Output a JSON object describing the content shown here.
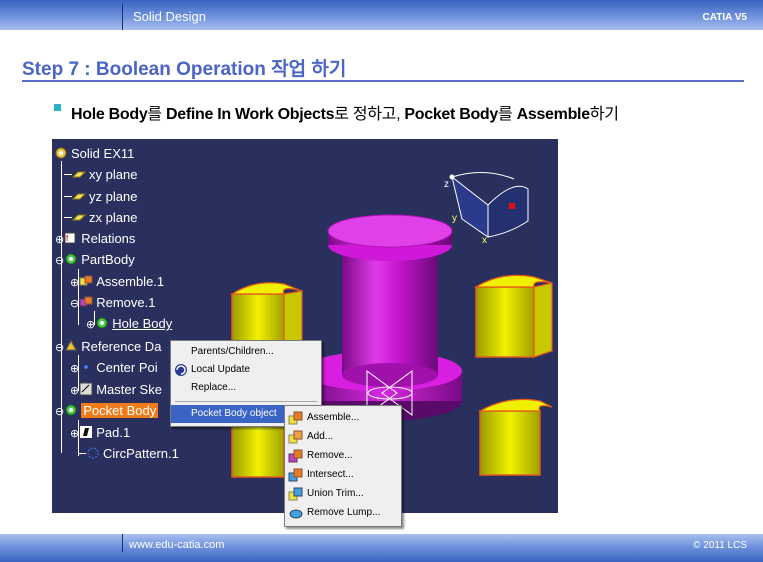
{
  "header": {
    "left": "Solid Design",
    "right": "CATIA V5"
  },
  "footer": {
    "left": "www.edu-catia.com",
    "right": "© 2011 LCS"
  },
  "title": "Step 7 : Boolean Operation 작업 하기",
  "bullet": {
    "p1": "Hole Body",
    "p2": "를 ",
    "p3": "Define In Work Objects",
    "p4": "로 정하고, ",
    "p5": "Pocket Body",
    "p6": "를 ",
    "p7": "Assemble",
    "p8": "하기"
  },
  "tree": {
    "root": "Solid EX11",
    "xy": "xy plane",
    "yz": "yz plane",
    "zx": "zx plane",
    "relations": "Relations",
    "partbody": "PartBody",
    "assemble1": "Assemble.1",
    "remove1": "Remove.1",
    "holebody": "Hole Body",
    "refdata": "Reference Da",
    "centerpoint": "Center Poi",
    "mastersketch": "Master Ske",
    "pocketbody": "Pocket Body",
    "pad1": "Pad.1",
    "circpattern": "CircPattern.1"
  },
  "context_menu": {
    "parents": "Parents/Children...",
    "local_update": "Local Update",
    "replace": "Replace...",
    "pocket_object": "Pocket Body object"
  },
  "submenu": {
    "assemble": "Assemble...",
    "add": "Add...",
    "remove": "Remove...",
    "intersect": "Intersect...",
    "union_trim": "Union Trim...",
    "remove_lump": "Remove Lump..."
  },
  "compass": {
    "x": "x",
    "y": "y",
    "z": "z"
  },
  "colors": {
    "title": "#4a64c7",
    "viewport_bg": "#29305e",
    "selection": "#f07b1a",
    "menu_highlight": "#3a63c6",
    "solid_magenta": "#d018d8",
    "solid_yellow": "#e8e800"
  }
}
